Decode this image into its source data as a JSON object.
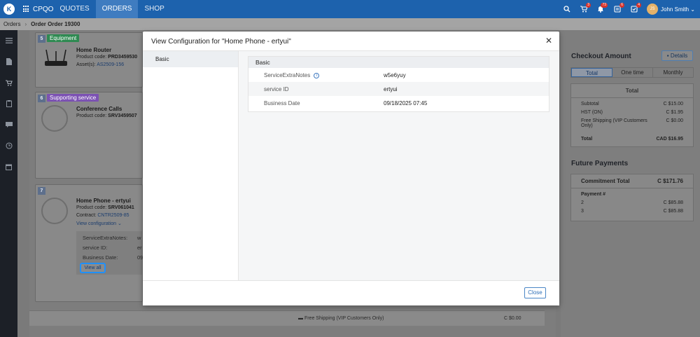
{
  "nav": {
    "brand": "CPQO",
    "items": [
      {
        "label": "QUOTES",
        "active": false
      },
      {
        "label": "ORDERS",
        "active": true
      },
      {
        "label": "SHOP",
        "active": false
      }
    ],
    "badges": {
      "cart": "3",
      "notifications": "73",
      "tasks": "6",
      "approvals": "4"
    },
    "user": {
      "initials": "JS",
      "name": "John Smith"
    }
  },
  "breadcrumb": {
    "root": "Orders",
    "current": "Order Order 19300"
  },
  "cards": [
    {
      "num": "5",
      "tag": "Equipment",
      "tag_color": "#2f8a52",
      "title": "Home Router",
      "code_label": "Product code:",
      "code": "PRD3459530",
      "asset_label": "Asset(s):",
      "asset": "AS2509-156"
    },
    {
      "num": "6",
      "tag": "Supporting service",
      "tag_color": "#7c52b3",
      "title": "Conference Calls",
      "code_label": "Product code:",
      "code": "SRV3459507"
    },
    {
      "num": "7",
      "title": "Home Phone - ertyui",
      "code_label": "Product code:",
      "code": "SRV061041",
      "contract_label": "Contract:",
      "contract": "CNTR2509-85",
      "view_config": "View configuration",
      "kv": [
        {
          "label": "ServiceExtraNotes:",
          "value": "w"
        },
        {
          "label": "service ID:",
          "value": "er"
        },
        {
          "label": "Business Date:",
          "value": "09"
        }
      ],
      "view_all": "View all"
    }
  ],
  "shipping": {
    "label": "Free Shipping (VIP Customers Only)",
    "amount": "C $0.00"
  },
  "checkout": {
    "title": "Checkout Amount",
    "details": "Details",
    "tabs": [
      "Total",
      "One time",
      "Monthly"
    ],
    "panel_title": "Total",
    "rows": [
      {
        "label": "Subtotal",
        "value": "C $15.00"
      },
      {
        "label": "HST (ON)",
        "value": "C $1.95"
      },
      {
        "label": "Free Shipping (VIP Customers Only)",
        "value": "C $0.00"
      }
    ],
    "total_label": "Total",
    "total_value": "CAD $16.95"
  },
  "future": {
    "title": "Future Payments",
    "commitment_label": "Commitment Total",
    "commitment_value": "C $171.76",
    "payment_label": "Payment #",
    "payments": [
      {
        "num": "2",
        "value": "C $85.88"
      },
      {
        "num": "3",
        "value": "C $85.88"
      }
    ]
  },
  "modal": {
    "title": "View Configuration for \"Home Phone - ertyui\"",
    "side_item": "Basic",
    "section_title": "Basic",
    "fields": [
      {
        "label": "ServiceExtraNotes",
        "value": "w5e6yuy",
        "info": true
      },
      {
        "label": "service ID",
        "value": "ertyui"
      },
      {
        "label": "Business Date",
        "value": "09/18/2025 07:45"
      }
    ],
    "close_label": "Close"
  }
}
